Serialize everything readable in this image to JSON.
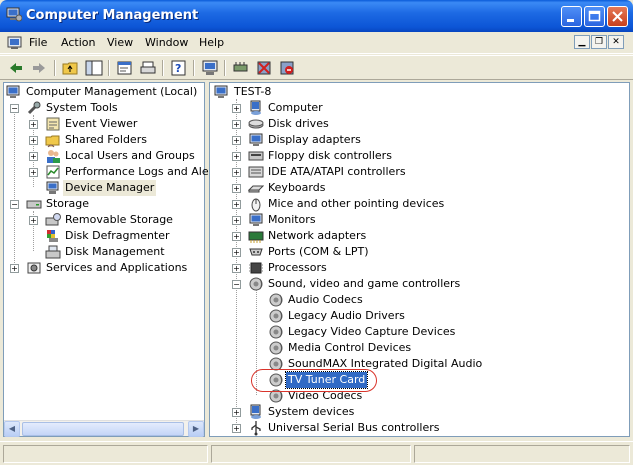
{
  "window": {
    "title": "Computer Management",
    "icon": "computer-management-icon"
  },
  "menu": {
    "items": [
      {
        "label": "File",
        "icon": "file-menu"
      },
      {
        "label": "Action"
      },
      {
        "label": "View"
      },
      {
        "label": "Window"
      },
      {
        "label": "Help"
      }
    ]
  },
  "left_tree": {
    "root": "Computer Management (Local)",
    "items": [
      {
        "label": "System Tools"
      },
      {
        "label": "Event Viewer"
      },
      {
        "label": "Shared Folders"
      },
      {
        "label": "Local Users and Groups"
      },
      {
        "label": "Performance Logs and Alerts"
      },
      {
        "label": "Device Manager",
        "state": "selected-inactive"
      },
      {
        "label": "Storage"
      },
      {
        "label": "Removable Storage"
      },
      {
        "label": "Disk Defragmenter"
      },
      {
        "label": "Disk Management"
      },
      {
        "label": "Services and Applications"
      }
    ]
  },
  "right_tree": {
    "root": "TEST-8",
    "categories": [
      {
        "label": "Computer"
      },
      {
        "label": "Disk drives"
      },
      {
        "label": "Display adapters"
      },
      {
        "label": "Floppy disk controllers"
      },
      {
        "label": "IDE ATA/ATAPI controllers"
      },
      {
        "label": "Keyboards"
      },
      {
        "label": "Mice and other pointing devices"
      },
      {
        "label": "Monitors"
      },
      {
        "label": "Network adapters"
      },
      {
        "label": "Ports (COM & LPT)"
      },
      {
        "label": "Processors"
      },
      {
        "label": "Sound, video and game controllers",
        "expanded": true
      }
    ],
    "sound_children": [
      {
        "label": "Audio Codecs"
      },
      {
        "label": "Legacy Audio Drivers"
      },
      {
        "label": "Legacy Video Capture Devices"
      },
      {
        "label": "Media Control Devices"
      },
      {
        "label": "SoundMAX Integrated Digital Audio"
      },
      {
        "label": "TV Tuner Card",
        "state": "selected"
      },
      {
        "label": "Video Codecs"
      }
    ],
    "after": [
      {
        "label": "System devices"
      },
      {
        "label": "Universal Serial Bus controllers"
      }
    ]
  },
  "colors": {
    "titlebar": "#0c55d6",
    "selection": "#316ac5",
    "highlight_ring": "#d9342b"
  }
}
